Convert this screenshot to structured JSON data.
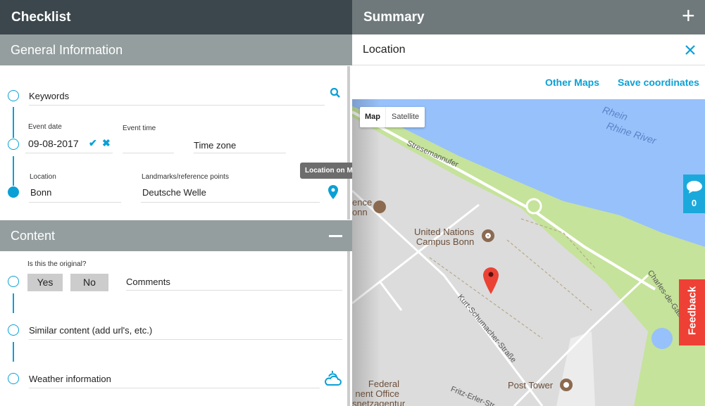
{
  "left": {
    "title": "Checklist",
    "general": {
      "title": "General Information",
      "keywords": "Keywords",
      "event_date_label": "Event date",
      "event_date": "09-08-2017",
      "event_time_label": "Event time",
      "time_zone": "Time zone",
      "location_label": "Location",
      "location": "Bonn",
      "landmarks_label": "Landmarks/reference points",
      "landmarks": "Deutsche Welle",
      "tooltip": "Location on Maps"
    },
    "content": {
      "title": "Content",
      "original_label": "Is this the original?",
      "yes": "Yes",
      "no": "No",
      "comments": "Comments",
      "similar": "Similar content (add url's, etc.)",
      "weather": "Weather information"
    }
  },
  "right": {
    "title": "Summary",
    "location_title": "Location",
    "other_maps": "Other Maps",
    "save_coordinates": "Save coordinates",
    "map": {
      "type_map": "Map",
      "type_satellite": "Satellite",
      "selected_type": "Map",
      "labels": {
        "river1": "Rhein",
        "river2": "Rhine River",
        "street1": "Stresemannufer",
        "poi1a": "ence",
        "poi1b": "onn",
        "poi2a": "United Nations",
        "poi2b": "Campus Bonn",
        "street2": "Kurt-Schumacher-Straße",
        "street3": "Charles-de-Gaulle-Straße",
        "poi3": "Post Tower",
        "poi4a": "Federal",
        "poi4b": "nent Office",
        "poi4c": "snetzagentur",
        "street4": "Fritz-Erler-Str"
      }
    },
    "comments_count": "0",
    "feedback": "Feedback"
  },
  "colors": {
    "accent": "#0aa0d6",
    "header_dark": "#3b474c",
    "header_gray": "#6f797c",
    "section": "#959e9f",
    "feedback": "#ee4035",
    "water": "#97c1fa",
    "park": "#c5e39a"
  }
}
